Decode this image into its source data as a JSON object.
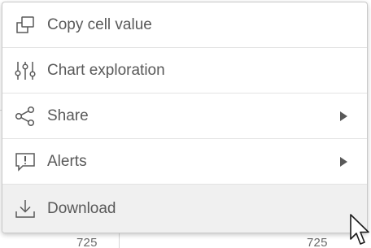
{
  "menu": {
    "items": [
      {
        "label": "Copy cell value",
        "icon": "copy-icon",
        "submenu": false
      },
      {
        "label": "Chart exploration",
        "icon": "sliders-icon",
        "submenu": false
      },
      {
        "label": "Share",
        "icon": "share-icon",
        "submenu": true
      },
      {
        "label": "Alerts",
        "icon": "alert-icon",
        "submenu": true
      },
      {
        "label": "Download",
        "icon": "download-icon",
        "submenu": false,
        "hovered": true
      }
    ]
  },
  "table": {
    "visible_values": [
      "725",
      "725"
    ]
  },
  "colors": {
    "text": "#595959",
    "hover_bg": "#f0f0f0",
    "border": "#c9c9c9"
  }
}
